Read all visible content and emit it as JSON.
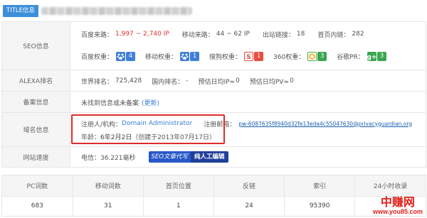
{
  "header": {
    "badge": "TITLE信息"
  },
  "seo": {
    "label": "SEO信息",
    "baidu_source_label": "百度来路：",
    "baidu_source_value": "1,997 ~ 2,740 IP",
    "mobile_source_label": "移动来路：",
    "mobile_source_value": "44 ~ 62 IP",
    "outlinks_label": "出站链接：",
    "outlinks_value": "18",
    "homepage_inlinks_label": "首页内链：",
    "homepage_inlinks_value": "282",
    "baidu_weight_label": "百度权重：",
    "baidu_weight_value": "4",
    "mobile_weight_label": "移动权重：",
    "mobile_weight_value": "1",
    "sogou_weight_label": "搜狗权重：",
    "sogou_weight_value": "1",
    "s360_weight_label": "360权重：",
    "s360_weight_value": "3",
    "google_pr_label": "谷歌PR：",
    "google_pr_value": "3"
  },
  "alexa": {
    "label": "ALEXA排名",
    "world_rank_label": "世界排名：",
    "world_rank_value": "725,428",
    "domestic_rank_label": "国内排名：",
    "domestic_rank_value": "-",
    "daily_ip_label": "预估日均IP≈",
    "daily_ip_value": "0",
    "daily_pv_label": "预估日均PV≈",
    "daily_pv_value": "0"
  },
  "icp": {
    "label": "备案信息",
    "status": "未找到信息或未备案",
    "update": "(更新)"
  },
  "domain": {
    "label": "域名信息",
    "registrant_label": "注册人/机构：",
    "registrant_value": "Domain Administrator",
    "email_label": "注册邮箱：",
    "email_value": "pw-6087635f8940d32fe13eda4c55047630@privacyguardian.org",
    "age_label": "年龄：",
    "age_value": "6年2月2日",
    "created": "（创建于2013年07月17日）"
  },
  "speed": {
    "label": "网站速度",
    "telecom_label": "电信：",
    "telecom_value": "36.221毫秒",
    "badge_a": "SEO文章代写",
    "badge_b": "纯人工编辑"
  },
  "stats": {
    "headers": [
      "PC词数",
      "移动词数",
      "首页位置",
      "反链",
      "索引",
      "24小时收录"
    ],
    "values": [
      "683",
      "31",
      "1",
      "24",
      "95390",
      ""
    ]
  },
  "watermark": {
    "cn": "中赚网",
    "url": "www.you85.com"
  },
  "colors": {
    "accent_red": "#e2312a",
    "link_blue": "#3a7fd1",
    "badge_blue": "#3d8ed8"
  }
}
